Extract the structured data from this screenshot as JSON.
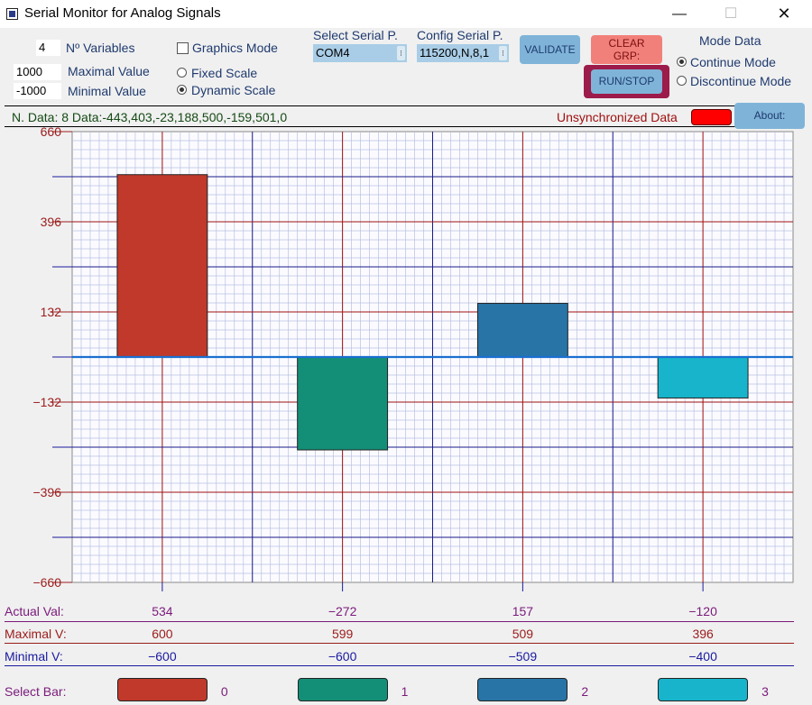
{
  "window": {
    "title": "Serial Monitor for Analog Signals",
    "minimize": "—",
    "maximize": "☐",
    "close": "✕"
  },
  "controls": {
    "n_variables": "4",
    "n_variables_label": "Nº Variables",
    "max_value": "1000",
    "max_value_label": "Maximal Value",
    "min_value": "-1000",
    "min_value_label": "Minimal Value",
    "graphics_mode_label": "Graphics Mode",
    "graphics_mode_checked": false,
    "scale_options": [
      {
        "label": "Fixed Scale",
        "selected": false
      },
      {
        "label": "Dynamic Scale",
        "selected": true
      }
    ],
    "serial_port_label": "Select Serial P.",
    "serial_port_value": "COM4",
    "config_label": "Config Serial P.",
    "config_value": "115200,N,8,1",
    "validate_label": "VALIDATE",
    "clear_label_1": "CLEAR",
    "clear_label_2": "GRP:",
    "runstop_label": "RUN/STOP",
    "mode_label": "Mode Data",
    "mode_options": [
      {
        "label": "Continue Mode",
        "selected": true
      },
      {
        "label": "Discontinue Mode",
        "selected": false
      }
    ]
  },
  "status": {
    "data_text": "N. Data: 8 Data:-443,403,-23,188,500,-159,501,0",
    "unsync_label": "Unsynchronized Data",
    "unsync_color": "#ff0000",
    "about_label": "About:"
  },
  "chart_data": {
    "type": "bar",
    "y_ticks": [
      "660",
      "396",
      "132",
      "−132",
      "−396",
      "−660"
    ],
    "ylim": [
      -660,
      660
    ],
    "categories": [
      "0",
      "1",
      "2",
      "3"
    ],
    "values": [
      534,
      -272,
      157,
      -120
    ],
    "colors": [
      "#c0392b",
      "#148f77",
      "#2874a6",
      "#17b4cc"
    ]
  },
  "table": {
    "actual_label": "Actual Val:",
    "actual": [
      "534",
      "−272",
      "157",
      "−120"
    ],
    "max_label": "Maximal V:",
    "max": [
      "600",
      "599",
      "509",
      "396"
    ],
    "min_label": "Minimal V:",
    "min": [
      "−600",
      "−600",
      "−509",
      "−400"
    ],
    "select_label": "Select Bar:",
    "select_ids": [
      "0",
      "1",
      "2",
      "3"
    ]
  },
  "colors": {
    "label_purple": "#7a1a7a",
    "label_red": "#9b1b1b",
    "label_blue": "#1a1aa0",
    "grid_red": "#a01010",
    "grid_blue": "#1a1a8a",
    "grid_minor": "#b8c0e0"
  }
}
